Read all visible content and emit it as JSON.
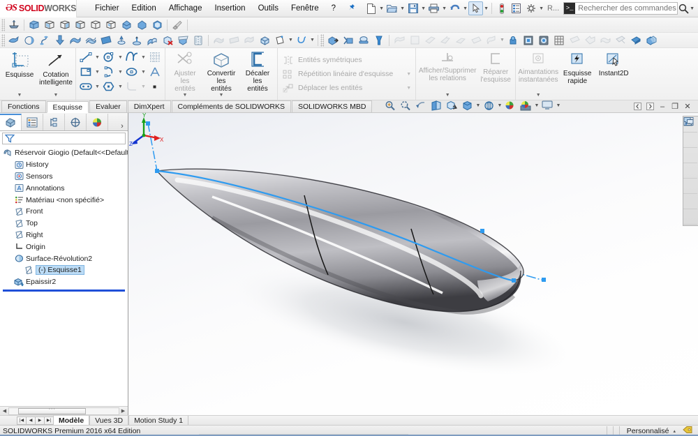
{
  "app": {
    "brand_ds": "2DS",
    "brand_solid": "SOLID",
    "brand_works": "WORKS"
  },
  "menu": {
    "items": [
      {
        "label": "Fichier"
      },
      {
        "label": "Edition"
      },
      {
        "label": "Affichage"
      },
      {
        "label": "Insertion"
      },
      {
        "label": "Outils"
      },
      {
        "label": "Fenêtre"
      },
      {
        "label": "?"
      }
    ],
    "pin_icon": "pushpin-icon"
  },
  "quickaccess": {
    "buttons": [
      {
        "name": "new-document-icon",
        "has_caret": true
      },
      {
        "name": "open-document-icon",
        "has_caret": true
      },
      {
        "name": "save-icon",
        "has_caret": true
      },
      {
        "name": "print-icon",
        "has_caret": true
      },
      {
        "name": "undo-icon",
        "has_caret": true
      },
      {
        "name": "select-arrow-icon",
        "has_caret": true,
        "selected": true
      },
      {
        "name": "rebuild-icon",
        "has_caret": false
      },
      {
        "name": "options-list-icon",
        "has_caret": false
      },
      {
        "name": "settings-gear-icon",
        "has_caret": true
      }
    ],
    "truncated_label": "R...",
    "window_buttons": [
      "?",
      "▾",
      "–",
      "❐",
      "✕"
    ]
  },
  "search": {
    "placeholder": "Rechercher des commandes",
    "icon": "magnifier-icon"
  },
  "ribbon": {
    "groups": [
      {
        "name": "sketch-group",
        "buttons": [
          {
            "label": "Esquisse",
            "icon": "sketch-icon",
            "dropdown": true,
            "dimmed": false
          },
          {
            "label": "Cotation\nintelligente",
            "icon": "smart-dimension-icon",
            "dropdown": true,
            "dimmed": false
          }
        ]
      },
      {
        "name": "entities-grid",
        "icons": [
          [
            "line-icon",
            "circle-icon",
            "spline-icon",
            "grid-icon"
          ],
          [
            "rectangle-icon",
            "arc-icon",
            "ellipse-icon",
            "text-icon"
          ],
          [
            "slot-icon",
            "polygon-icon",
            "fillet-icon",
            "point-icon"
          ]
        ]
      },
      {
        "name": "edit-entities-group",
        "buttons": [
          {
            "label": "Ajuster\nles\nentités",
            "icon": "trim-entities-icon",
            "dropdown": true,
            "dimmed": true
          },
          {
            "label": "Convertir\nles\nentités",
            "icon": "convert-entities-icon",
            "dropdown": true,
            "dimmed": false
          },
          {
            "label": "Décaler\nles\nentités",
            "icon": "offset-entities-icon",
            "dropdown": false,
            "dimmed": false
          }
        ]
      },
      {
        "name": "pattern-group",
        "rows": [
          {
            "label": "Entités symétriques",
            "icon": "mirror-entities-icon",
            "caret": false
          },
          {
            "label": "Répétition linéaire d'esquisse",
            "icon": "linear-pattern-icon",
            "caret": true
          },
          {
            "label": "Déplacer les entités",
            "icon": "move-entities-icon",
            "caret": true
          }
        ]
      },
      {
        "name": "relations-group",
        "buttons": [
          {
            "label": "Afficher/Supprimer\nles relations",
            "icon": "display-relations-icon",
            "dropdown": true,
            "dimmed": true
          },
          {
            "label": "Réparer\nl'esquisse",
            "icon": "repair-sketch-icon",
            "dropdown": false,
            "dimmed": true
          }
        ]
      },
      {
        "name": "snaps-group",
        "buttons": [
          {
            "label": "Aimantations\ninstantanées",
            "icon": "quick-snaps-icon",
            "dropdown": true,
            "dimmed": true
          },
          {
            "label": "Esquisse\nrapide",
            "icon": "rapid-sketch-icon",
            "dropdown": false,
            "dimmed": false
          },
          {
            "label": "Instant2D",
            "icon": "instant2d-icon",
            "dropdown": false,
            "dimmed": false
          }
        ]
      }
    ]
  },
  "tabs": {
    "items": [
      {
        "label": "Fonctions",
        "active": false
      },
      {
        "label": "Esquisse",
        "active": true
      },
      {
        "label": "Evaluer",
        "active": false
      },
      {
        "label": "DimXpert",
        "active": false
      },
      {
        "label": "Compléments de SOLIDWORKS",
        "active": false
      },
      {
        "label": "SOLIDWORKS MBD",
        "active": false
      }
    ],
    "viewport_tools": [
      {
        "name": "zoom-to-fit-icon",
        "caret": false
      },
      {
        "name": "zoom-area-icon",
        "caret": false
      },
      {
        "name": "previous-view-icon",
        "caret": false
      },
      {
        "name": "section-view-icon",
        "caret": false
      },
      {
        "name": "view-orientation-icon",
        "caret": false
      },
      {
        "name": "display-style-icon",
        "caret": true
      },
      {
        "name": "hide-show-items-icon",
        "caret": true
      },
      {
        "name": "edit-appearance-icon",
        "caret": true
      },
      {
        "name": "apply-scene-icon",
        "caret": false
      },
      {
        "name": "view-settings-icon",
        "caret": true
      },
      {
        "name": "viewport-layout-icon",
        "caret": true
      }
    ],
    "window_controls": [
      "◁",
      "▷",
      "–",
      "❐",
      "✕"
    ]
  },
  "feature_manager": {
    "tabs": [
      {
        "name": "feature-tree-tab",
        "icon": "feature-tree-icon",
        "active": true
      },
      {
        "name": "property-manager-tab",
        "icon": "property-manager-icon",
        "active": false
      },
      {
        "name": "configuration-manager-tab",
        "icon": "configuration-icon",
        "active": false
      },
      {
        "name": "dimxpert-manager-tab",
        "icon": "dimxpert-icon",
        "active": false
      },
      {
        "name": "display-manager-tab",
        "icon": "display-manager-icon",
        "active": false
      }
    ],
    "more_icon": "chevron-right-icon",
    "filter_icon": "filter-funnel-icon",
    "tree": [
      {
        "label": "Réservoir Giogio  (Default<<Default>_Phot",
        "icon": "part-icon",
        "indent": 0,
        "selected": false
      },
      {
        "label": "History",
        "icon": "history-icon",
        "indent": 1,
        "selected": false
      },
      {
        "label": "Sensors",
        "icon": "sensors-icon",
        "indent": 1,
        "selected": false
      },
      {
        "label": "Annotations",
        "icon": "annotations-icon",
        "indent": 1,
        "selected": false
      },
      {
        "label": "Matériau <non spécifié>",
        "icon": "material-icon",
        "indent": 1,
        "selected": false
      },
      {
        "label": "Front",
        "icon": "plane-icon",
        "indent": 1,
        "selected": false
      },
      {
        "label": "Top",
        "icon": "plane-icon",
        "indent": 1,
        "selected": false
      },
      {
        "label": "Right",
        "icon": "plane-icon",
        "indent": 1,
        "selected": false
      },
      {
        "label": "Origin",
        "icon": "origin-icon",
        "indent": 1,
        "selected": false
      },
      {
        "label": "Surface-Révolution2",
        "icon": "revolve-surface-icon",
        "indent": 1,
        "selected": false
      },
      {
        "label": "(-) Esquisse1",
        "icon": "sketch-tree-icon",
        "indent": 2,
        "selected": true
      },
      {
        "label": "Epaissir2",
        "icon": "thicken-icon",
        "indent": 1,
        "selected": false
      }
    ]
  },
  "task_pane": {
    "items": [
      {
        "name": "solidworks-resources-icon",
        "label": "home-icon"
      },
      {
        "name": "design-library-icon",
        "label": "library-icon"
      },
      {
        "name": "file-explorer-icon",
        "label": "folder-icon"
      },
      {
        "name": "view-palette-icon",
        "label": "palette-icon"
      },
      {
        "name": "appearances-scenes-icon",
        "label": "appearance-ball-icon"
      },
      {
        "name": "custom-properties-icon",
        "label": "properties-icon"
      },
      {
        "name": "solidworks-forum-icon",
        "label": "forum-icon"
      }
    ]
  },
  "viewport": {
    "triad": {
      "x_label": "X",
      "y_label": "Y",
      "z_label": "Z",
      "x_color": "#e02020",
      "y_color": "#18a018",
      "z_color": "#1434d0"
    },
    "sketch_color": "#2e9bf0",
    "model_name": "revolved-tank-body"
  },
  "document_bar": {
    "nav": [
      "◀◀",
      "◀",
      "▶",
      "▶▶"
    ],
    "tabs": [
      {
        "label": "Modèle",
        "active": true
      },
      {
        "label": "Vues 3D",
        "active": false
      },
      {
        "label": "Motion Study 1",
        "active": false
      }
    ]
  },
  "status_bar": {
    "text": "SOLIDWORKS Premium 2016 x64 Edition",
    "units_label": "Personnalisé",
    "units_caret": "▴",
    "tag_icon": "tag-icon"
  }
}
